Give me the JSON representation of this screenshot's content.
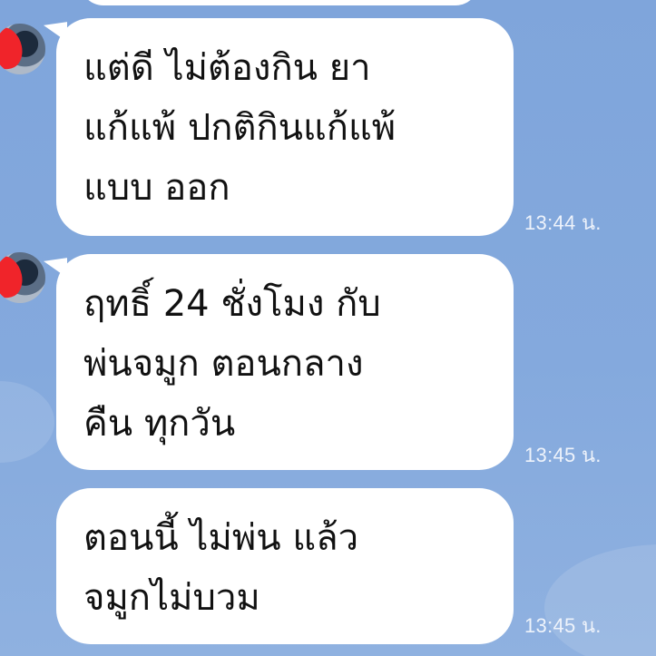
{
  "messages": [
    {
      "lines": [
        "แต่ดี ไม่ต้องกิน ยา",
        "แก้แพ้  ปกติกินแก้แพ้",
        "แบบ ออก"
      ],
      "time": "13:44 น."
    },
    {
      "lines": [
        "ฤทธิ์  24 ชั่งโมง  กับ",
        "พ่นจมูก ตอนกลาง",
        "คืน  ทุกวัน"
      ],
      "time": "13:45 น."
    },
    {
      "lines": [
        "ตอนนี้ ไม่พ่น แล้ว",
        "จมูกไม่บวม"
      ],
      "time": "13:45 น."
    }
  ],
  "colors": {
    "background": "#7fa5db",
    "bubble": "#ffffff",
    "timestamp": "#eef3fb",
    "avatar_redaction": "#f0242a"
  }
}
